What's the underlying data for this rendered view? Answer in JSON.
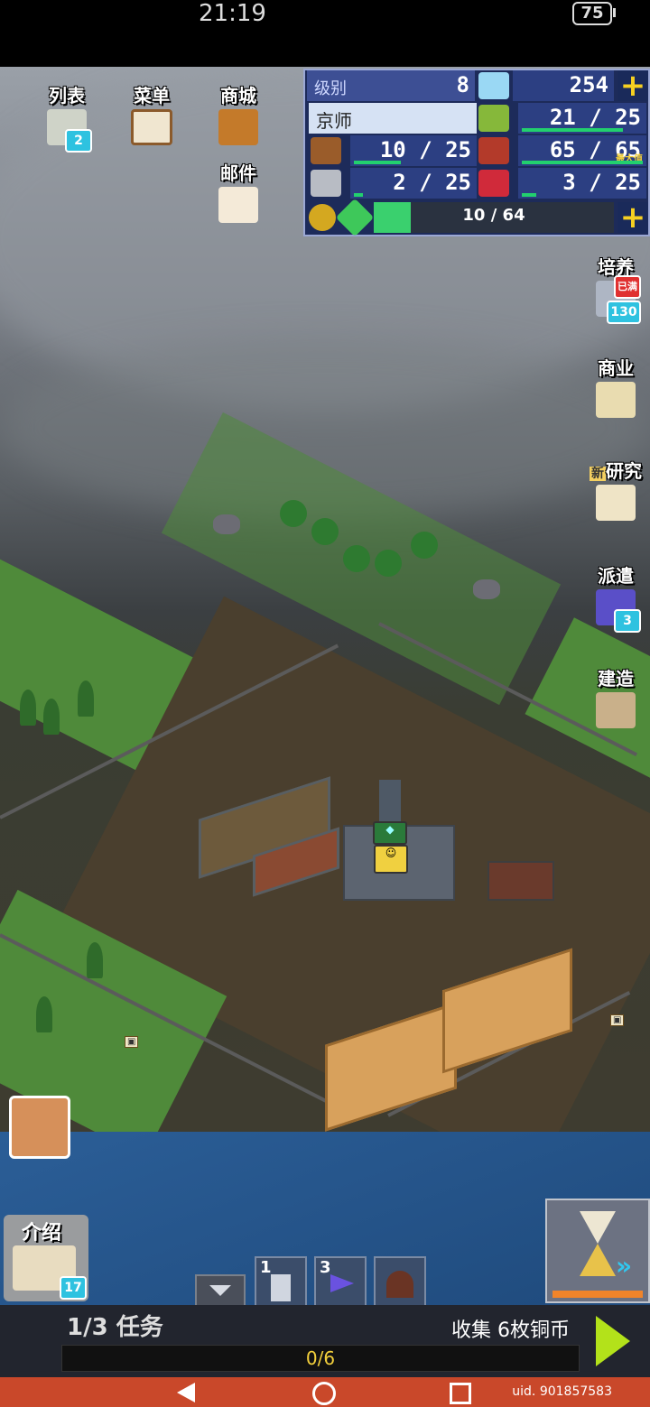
{
  "status_bar": {
    "time": "21:19",
    "battery": "75"
  },
  "top_left_buttons": [
    {
      "label": "列表",
      "badge": "2"
    },
    {
      "label": "菜单"
    },
    {
      "label": "商城"
    },
    {
      "label": "邮件"
    }
  ],
  "resources": {
    "level_label": "级别",
    "level_value": "8",
    "diamonds": "254",
    "city_name": "京师",
    "grain": "21 / 25",
    "wood": "10 / 25",
    "food": "65 / 65",
    "food_note": "最大值",
    "stone": "2 / 25",
    "ruby": "3 / 25",
    "exp": "10 / 64",
    "exp_fraction": 0.156
  },
  "right_buttons": [
    {
      "label": "培养",
      "tag": "已满",
      "badge": "130"
    },
    {
      "label": "商业"
    },
    {
      "label": "研究",
      "tag": "新"
    },
    {
      "label": "派遣",
      "badge": "3"
    },
    {
      "label": "建造"
    }
  ],
  "bottom_left": {
    "intro_label": "介绍",
    "intro_badge": "17"
  },
  "unit_slots": [
    {
      "count": "1"
    },
    {
      "count": "3"
    }
  ],
  "mission": {
    "count": "1/3",
    "title": "任务",
    "text": "收集 6枚铜币",
    "progress_text": "0/6",
    "progress": 0
  },
  "uid": "uid. 901857583",
  "colors": {
    "panel_bg": "#1d2b5a",
    "accent_plus": "#f6d021",
    "bar_green": "#22d06e",
    "nav_red": "#c9482a"
  }
}
